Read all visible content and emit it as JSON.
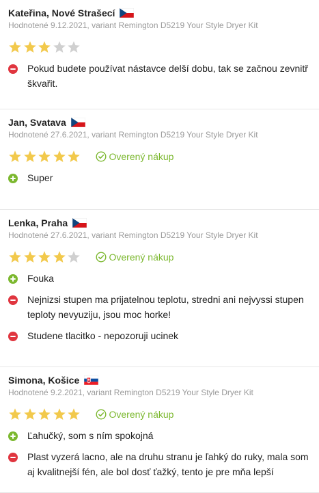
{
  "colors": {
    "star_on": "#f2c94c",
    "star_off": "#d0d0d0",
    "plus": "#7cb82f",
    "minus": "#e0353f",
    "verified": "#7cb82f"
  },
  "reviews": [
    {
      "author": "Kateřina, Nové Strašecí",
      "flag": "cz",
      "meta": "Hodnotené 9.12.2021, variant Remington D5219 Your Style Dryer Kit",
      "rating": 3,
      "verified": "",
      "items": [
        {
          "type": "minus",
          "text": "Pokud budete používat nástavce delší dobu, tak se začnou zevnitř škvařit."
        }
      ]
    },
    {
      "author": "Jan, Svatava",
      "flag": "cz",
      "meta": "Hodnotené 27.6.2021, variant Remington D5219 Your Style Dryer Kit",
      "rating": 5,
      "verified": "Overený nákup",
      "items": [
        {
          "type": "plus",
          "text": "Super"
        }
      ]
    },
    {
      "author": "Lenka, Praha",
      "flag": "cz",
      "meta": "Hodnotené 27.6.2021, variant Remington D5219 Your Style Dryer Kit",
      "rating": 4,
      "verified": "Overený nákup",
      "items": [
        {
          "type": "plus",
          "text": "Fouka"
        },
        {
          "type": "minus",
          "text": "Nejnizsi stupen ma prijatelnou teplotu, stredni ani nejvyssi stupen teploty nevyuziju, jsou moc horke!"
        },
        {
          "type": "minus",
          "text": "Studene tlacitko - nepozoruji ucinek"
        }
      ]
    },
    {
      "author": "Simona, Košice",
      "flag": "sk",
      "meta": "Hodnotené 9.2.2021, variant Remington D5219 Your Style Dryer Kit",
      "rating": 5,
      "verified": "Overený nákup",
      "items": [
        {
          "type": "plus",
          "text": "Ľahučký, som s ním spokojná"
        },
        {
          "type": "minus",
          "text": "Plast vyzerá lacno, ale na druhu stranu je ľahký do ruky, mala som aj kvalitnejší fén, ale bol dosť ťažký, tento je pre mňa lepší"
        }
      ]
    }
  ]
}
